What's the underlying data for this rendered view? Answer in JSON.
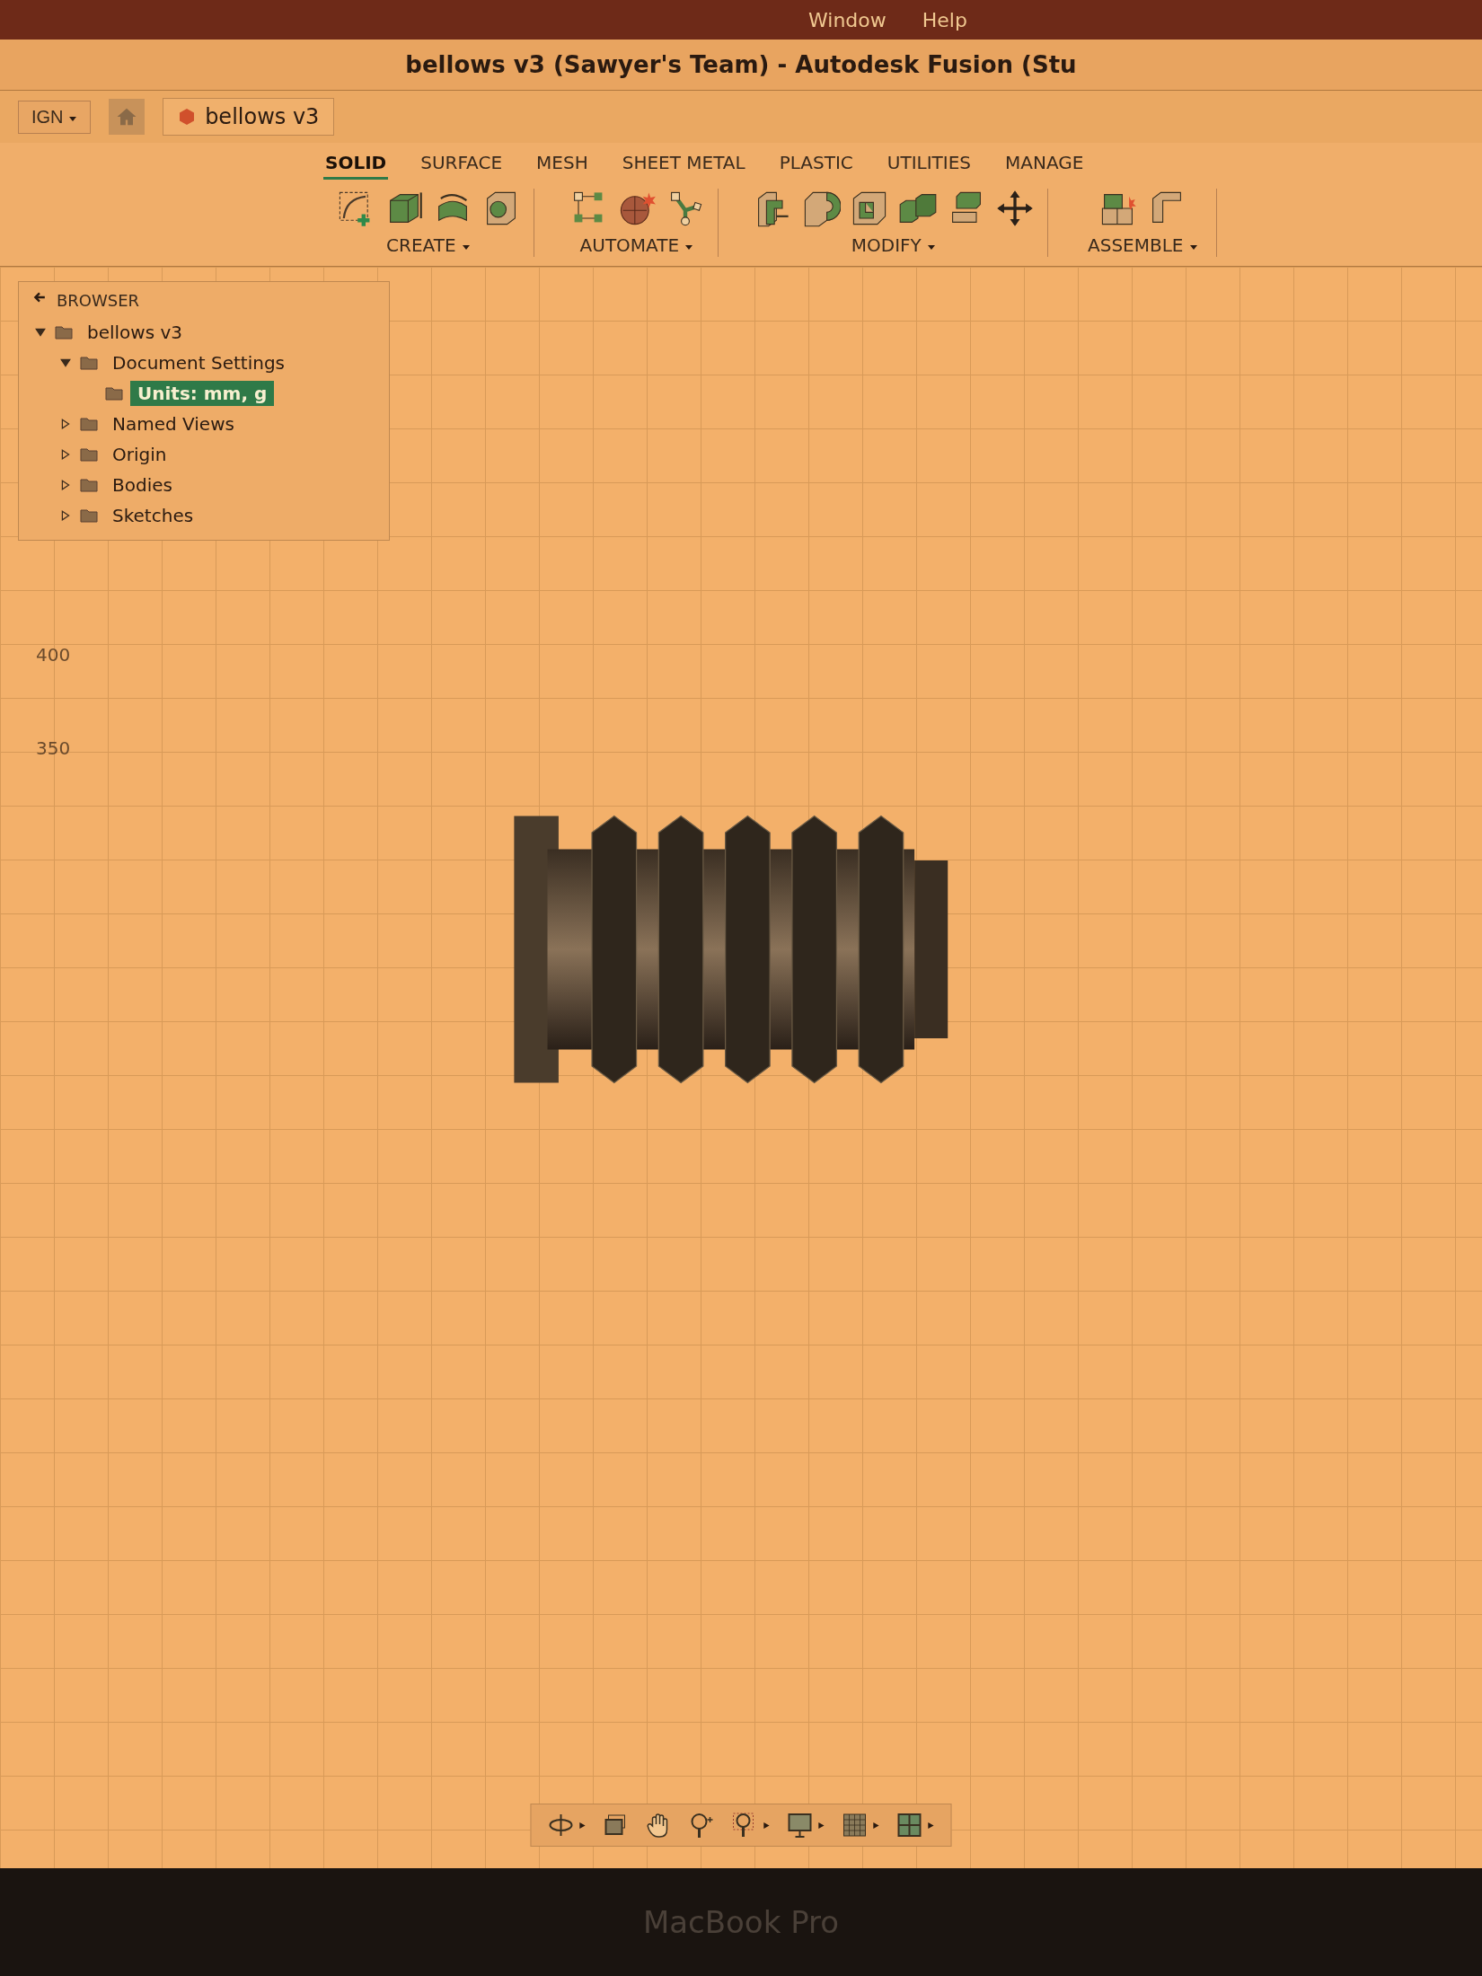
{
  "menu_bar": {
    "items": [
      "Window",
      "Help"
    ]
  },
  "title_bar": {
    "title": "bellows v3 (Sawyer's Team) - Autodesk Fusion (Stu"
  },
  "workspace": {
    "label": "IGN"
  },
  "document_tab": {
    "label": "bellows v3"
  },
  "toolbar": {
    "tabs": [
      {
        "label": "SOLID",
        "selected": true
      },
      {
        "label": "SURFACE",
        "selected": false
      },
      {
        "label": "MESH",
        "selected": false
      },
      {
        "label": "SHEET METAL",
        "selected": false
      },
      {
        "label": "PLASTIC",
        "selected": false
      },
      {
        "label": "UTILITIES",
        "selected": false
      },
      {
        "label": "MANAGE",
        "selected": false
      }
    ],
    "groups": [
      {
        "label": "CREATE",
        "icons": [
          {
            "kind": "sketch"
          },
          {
            "kind": "extrude"
          },
          {
            "kind": "revolve"
          },
          {
            "kind": "hole"
          }
        ]
      },
      {
        "label": "AUTOMATE",
        "icons": [
          {
            "kind": "mesh"
          },
          {
            "kind": "explode"
          },
          {
            "kind": "automate"
          }
        ]
      },
      {
        "label": "MODIFY",
        "icons": [
          {
            "kind": "plastic"
          },
          {
            "kind": "fillet"
          },
          {
            "kind": "shell"
          },
          {
            "kind": "combine"
          },
          {
            "kind": "align"
          },
          {
            "kind": "move"
          }
        ]
      },
      {
        "label": "ASSEMBLE",
        "icons": [
          {
            "kind": "joint"
          },
          {
            "kind": "bracket"
          }
        ]
      }
    ]
  },
  "browser": {
    "title": "BROWSER",
    "tree": [
      {
        "label": "bellows v3",
        "expanded": true,
        "selected": false,
        "children": [
          {
            "label": "Document Settings",
            "expanded": true,
            "selected": false,
            "children": [
              {
                "label": "Units: mm, g",
                "selected": true
              }
            ]
          },
          {
            "label": "Named Views",
            "expanded": false,
            "selected": false
          },
          {
            "label": "Origin",
            "expanded": false,
            "selected": false
          },
          {
            "label": "Bodies",
            "expanded": false,
            "selected": false
          },
          {
            "label": "Sketches",
            "expanded": false,
            "selected": false
          }
        ]
      }
    ]
  },
  "canvas": {
    "ruler_labels": [
      "400",
      "350"
    ]
  },
  "navigation_bar": {
    "icons": [
      {
        "kind": "orbit"
      },
      {
        "kind": "capture"
      },
      {
        "kind": "pan"
      },
      {
        "kind": "zoom"
      },
      {
        "kind": "fit"
      },
      {
        "kind": "display"
      },
      {
        "kind": "grid"
      },
      {
        "kind": "viewports"
      }
    ]
  },
  "bezel": {
    "label": "MacBook Pro"
  }
}
